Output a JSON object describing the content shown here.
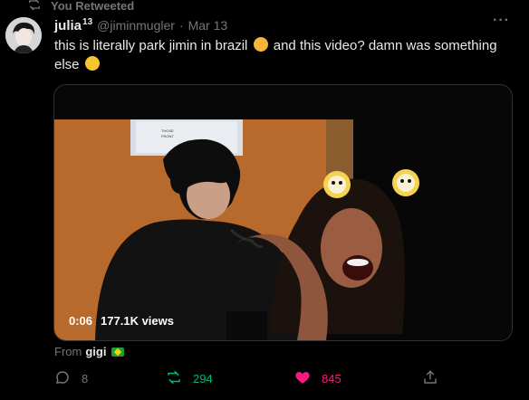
{
  "retweet_context": {
    "label": "You Retweeted",
    "icon": "retweet-icon"
  },
  "tweet": {
    "display_name": "julia",
    "name_badge": "13",
    "handle": "@jiminmugler",
    "separator": "·",
    "date": "Mar 13",
    "more_icon": "more-horizontal-icon",
    "text_part1": "this is literally park jimin in brazil",
    "text_part2": "and this video? damn was something else",
    "emoji_1": "smiling-cat-emoji",
    "emoji_2": "tears-of-joy-emoji"
  },
  "media": {
    "time": "0:06",
    "views": "177.1K views",
    "sign_text_1": "THOSE",
    "sign_text_2": "FRONT"
  },
  "source": {
    "prefix": "From",
    "user": "gigi",
    "flag": "brazil-flag"
  },
  "actions": {
    "reply": {
      "icon": "reply-icon",
      "count": "8",
      "color": "#71767b"
    },
    "retweet": {
      "icon": "retweet-icon",
      "count": "294",
      "color": "#00ba7c"
    },
    "like": {
      "icon": "heart-icon",
      "count": "845",
      "color": "#f91880"
    },
    "share": {
      "icon": "share-icon",
      "count": "",
      "color": "#71767b"
    }
  },
  "colors": {
    "background": "#000000",
    "text_primary": "#e7e9ea",
    "text_secondary": "#71767b",
    "retweet_green": "#00ba7c",
    "like_pink": "#f91880"
  }
}
